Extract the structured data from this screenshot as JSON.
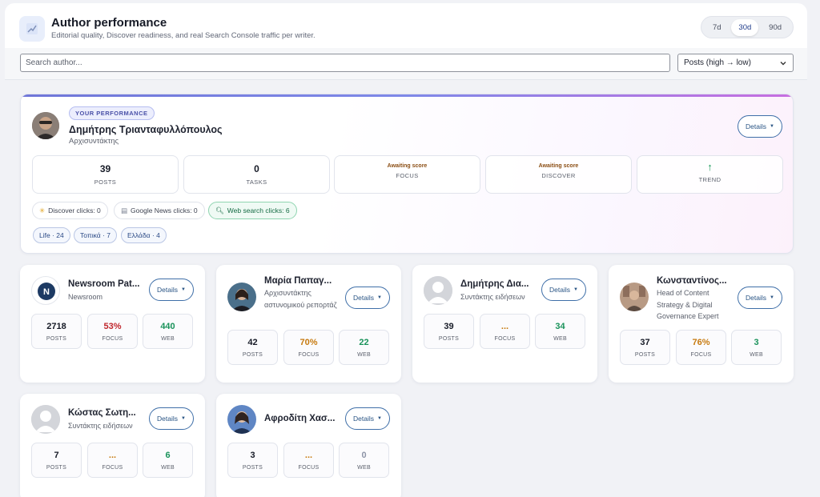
{
  "header": {
    "title": "Author performance",
    "subtitle": "Editorial quality, Discover readiness, and real Search Console traffic per writer.",
    "ranges": [
      "7d",
      "30d",
      "90d"
    ],
    "active_range": "30d"
  },
  "toolbar": {
    "search_placeholder": "Search author...",
    "sort_value": "Posts (high → low)"
  },
  "me": {
    "badge": "YOUR PERFORMANCE",
    "name": "Δημήτρης Τριανταφυλλόπουλος",
    "role": "Αρχισυντάκτης",
    "details_label": "Details",
    "stats": {
      "posts_value": "39",
      "posts_label": "POSTS",
      "tasks_value": "0",
      "tasks_label": "TASKS",
      "focus_status": "Awaiting score",
      "focus_label": "FOCUS",
      "discover_status": "Awaiting score",
      "discover_label": "DISCOVER",
      "trend_icon": "↑",
      "trend_label": "TREND"
    },
    "chips": {
      "discover": "Discover clicks: 0",
      "gnews": "Google News clicks: 0",
      "web": "Web search clicks: 6"
    },
    "tags": [
      "Life · 24",
      "Τοπικά · 7",
      "Ελλάδα · 4"
    ]
  },
  "labels": {
    "posts": "POSTS",
    "focus": "FOCUS",
    "web": "WEB",
    "details": "Details"
  },
  "authors": [
    {
      "name": "Newsroom Pat...",
      "role": "Newsroom",
      "posts": "2718",
      "focus": "53%",
      "web": "440"
    },
    {
      "name": "Μαρία Παπαγ...",
      "role": "Αρχισυντάκτης αστυνομικού ρεπορτάζ",
      "posts": "42",
      "focus": "70%",
      "web": "22"
    },
    {
      "name": "Δημήτρης Δια...",
      "role": "Συντάκτης ειδήσεων",
      "posts": "39",
      "focus": "...",
      "web": "34"
    },
    {
      "name": "Κωνσταντίνος...",
      "role": "Head of Content Strategy & Digital Governance Expert",
      "posts": "37",
      "focus": "76%",
      "web": "3"
    },
    {
      "name": "Κώστας Σωτη...",
      "role": "Συντάκτης ειδήσεων",
      "posts": "7",
      "focus": "...",
      "web": "6"
    },
    {
      "name": "Αφροδίτη Χασ...",
      "role": "",
      "posts": "3",
      "focus": "...",
      "web": "0"
    }
  ]
}
